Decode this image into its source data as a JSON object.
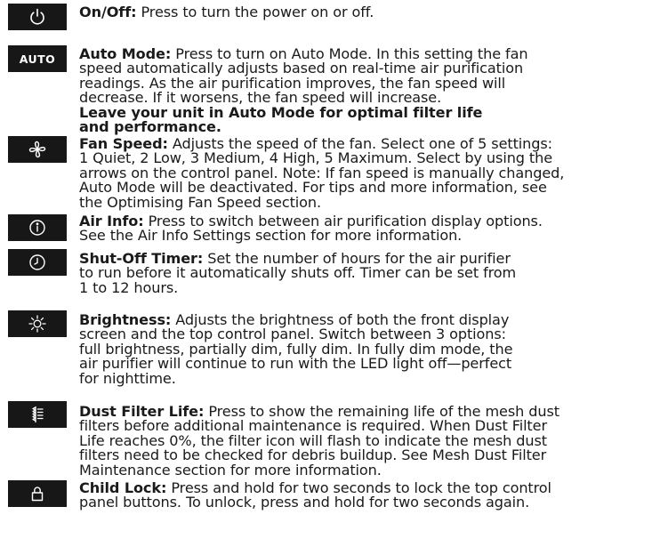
{
  "items": [
    {
      "icon": "power-icon",
      "title": "On/Off:",
      "lines": [
        "Press to turn the power on or off."
      ]
    },
    {
      "icon": "auto-icon",
      "icon_label": "AUTO",
      "title": "Auto Mode:",
      "lines": [
        "Press to turn on Auto Mode. In this setting the fan",
        "speed automatically adjusts based on real-time air purification",
        "readings. As the air purification improves, the fan speed will",
        "decrease. If it worsens, the fan speed will increase."
      ],
      "bold_lines": [
        "Leave your unit in Auto Mode for optimal filter life",
        "and performance."
      ]
    },
    {
      "icon": "fan-icon",
      "title": "Fan Speed:",
      "lines": [
        "Adjusts the speed of the fan. Select one of 5 settings:",
        "1 Quiet, 2 Low, 3 Medium, 4 High, 5 Maximum. Select by using the",
        "arrows on the control panel. Note: If fan speed is manually changed,",
        "Auto Mode will be deactivated. For tips and more information, see",
        "the Optimising Fan Speed section."
      ]
    },
    {
      "icon": "info-icon",
      "title": "Air Info:",
      "lines": [
        "Press to switch between air purification display options.",
        "See the Air Info Settings section for more information."
      ]
    },
    {
      "icon": "clock-icon",
      "title": "Shut-Off Timer:",
      "lines": [
        "Set the number of hours for the air purifier",
        "to run before it automatically shuts off. Timer can be set from",
        "1 to 12 hours."
      ]
    },
    {
      "icon": "brightness-icon",
      "title": "Brightness:",
      "lines": [
        "Adjusts the brightness of both the front display",
        "screen and the top control panel. Switch between 3 options:",
        "full brightness, partially dim, fully dim. In fully dim mode, the",
        "air purifier will continue to run with the LED light off—perfect",
        "for nighttime."
      ]
    },
    {
      "icon": "filter-icon",
      "title": "Dust Filter Life:",
      "lines": [
        " Press to show the remaining life of the mesh dust",
        "filters before additional maintenance is required. When Dust Filter",
        "Life reaches 0%, the filter icon will flash to indicate the mesh dust",
        "filters need to be checked for debris buildup. See Mesh Dust Filter",
        "Maintenance section for more information."
      ]
    },
    {
      "icon": "lock-icon",
      "title": "Child Lock:",
      "lines": [
        "Press and hold for two seconds to lock the top control",
        "panel buttons. To unlock, press and hold for two seconds again."
      ]
    }
  ]
}
